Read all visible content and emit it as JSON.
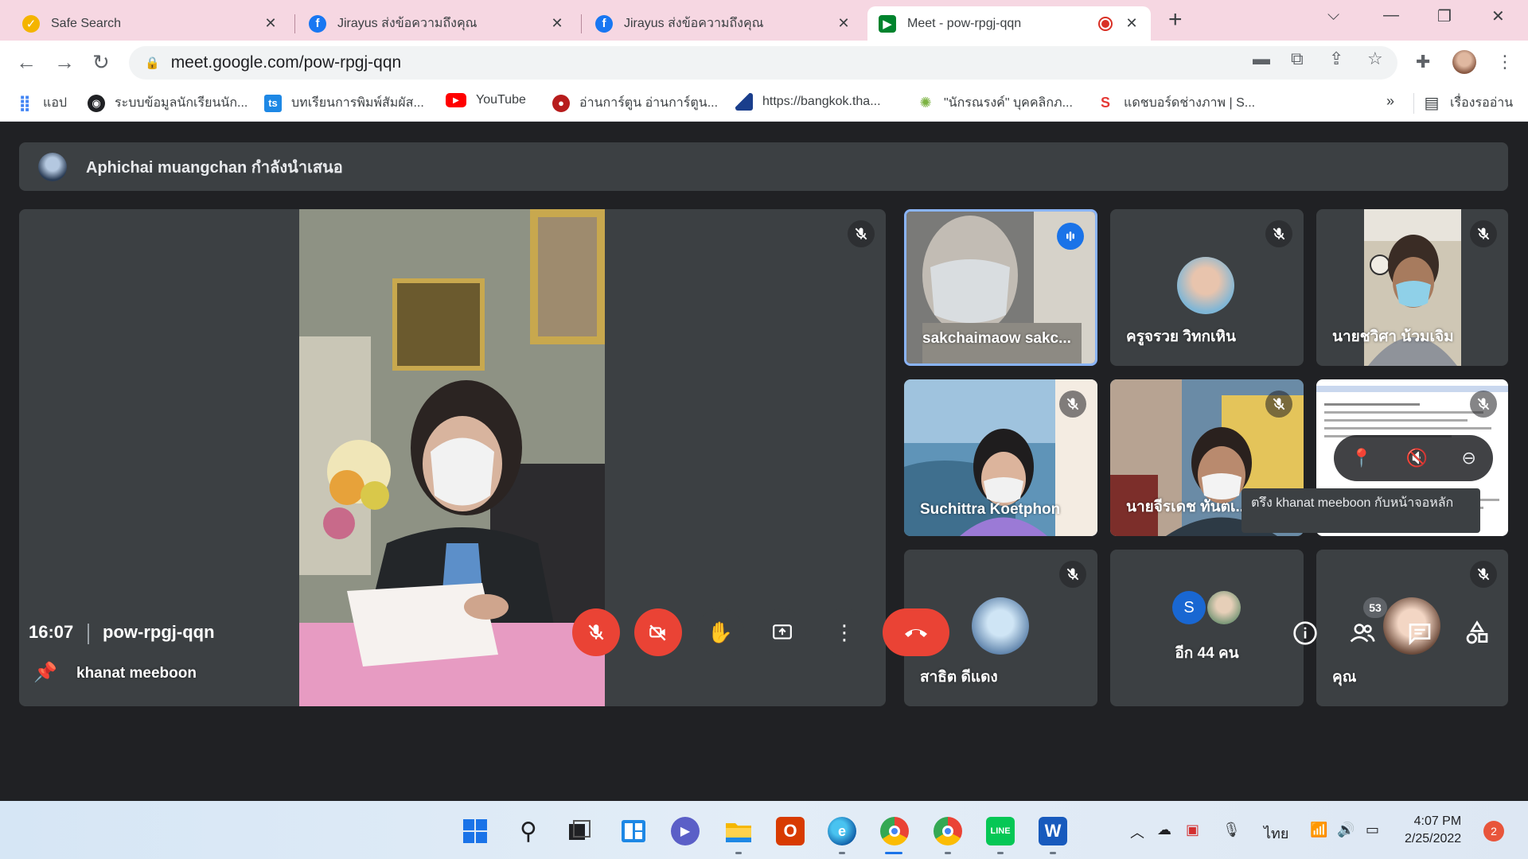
{
  "tabs": [
    {
      "title": "Safe Search",
      "icon": "check-favicon",
      "color": "#f4b400"
    },
    {
      "title": "Jirayus ส่งข้อความถึงคุณ",
      "icon": "facebook-favicon",
      "color": "#1877f2"
    },
    {
      "title": "Jirayus ส่งข้อความถึงคุณ",
      "icon": "facebook-favicon",
      "color": "#1877f2"
    },
    {
      "title": "Meet - pow-rpgj-qqn",
      "icon": "meet-favicon",
      "color": "#00832d"
    }
  ],
  "address": {
    "url": "meet.google.com/pow-rpgj-qqn"
  },
  "bookmarks": [
    {
      "label": "แอป"
    },
    {
      "label": "ระบบข้อมูลนักเรียนนัก..."
    },
    {
      "label": "บทเรียนการพิมพ์สัมผัส..."
    },
    {
      "label": "YouTube"
    },
    {
      "label": "อ่านการ์ตูน อ่านการ์ตูน..."
    },
    {
      "label": "https://bangkok.tha..."
    },
    {
      "label": "\"นักรณรงค์\" บุคคลิกภ..."
    },
    {
      "label": "แดชบอร์ดช่างภาพ | S..."
    },
    {
      "label": "»"
    },
    {
      "label": "เรื่องรออ่าน"
    }
  ],
  "presenting": {
    "text": "Aphichai muangchan กำลังนำเสนอ"
  },
  "main": {
    "name": "khanat meeboon"
  },
  "participants": [
    {
      "name": "sakchaimaow sakc...",
      "speaking": true
    },
    {
      "name": "ครูจรวย วิทกเหิน"
    },
    {
      "name": "นายชวิศา น้วมเจิม"
    },
    {
      "name": "Suchittra Koetphon"
    },
    {
      "name": "นายจีรเดช ทันตเ..."
    },
    {
      "name": "สาธิต ดีแดง"
    },
    {
      "name": "อีก 44 คน",
      "avatar_letter": "S"
    },
    {
      "name": "คุณ"
    }
  ],
  "tooltip": {
    "text": "ตรึง khanat meeboon กับหน้าจอหลัก"
  },
  "controls": {
    "time": "16:07",
    "meeting_code": "pow-rpgj-qqn",
    "participants_count": "53"
  },
  "taskbar": {
    "lang": "ไทย",
    "time": "4:07 PM",
    "date": "2/25/2022",
    "notifications": "2"
  },
  "colors": {
    "accent_red": "#ea4335",
    "speaking_blue": "#1a73e8",
    "tile_bg": "#3c4043",
    "meet_bg": "#202124"
  }
}
